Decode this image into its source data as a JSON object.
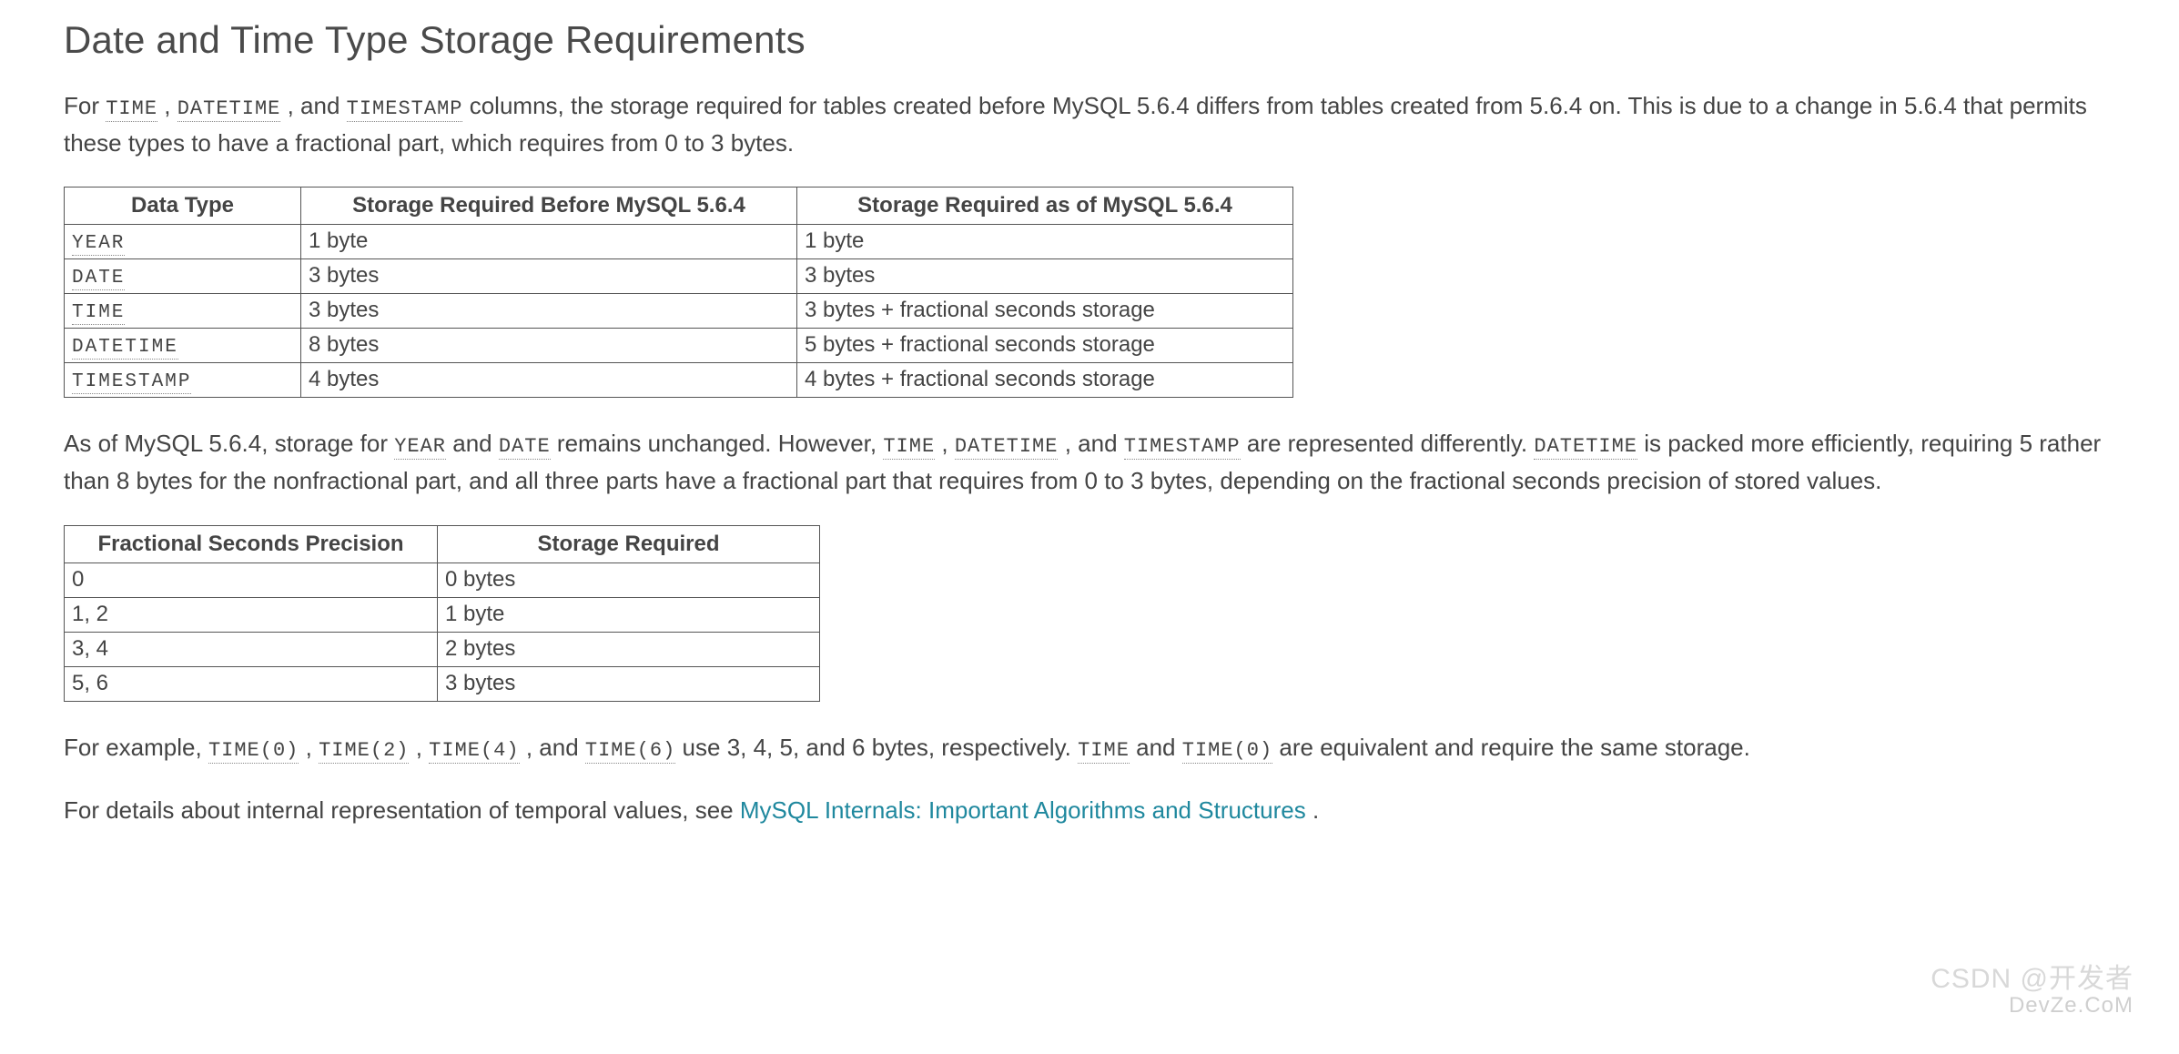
{
  "title": "Date and Time Type Storage Requirements",
  "para1": {
    "seg1": "For ",
    "code1": "TIME",
    "seg2": ", ",
    "code2": "DATETIME",
    "seg3": ", and ",
    "code3": "TIMESTAMP",
    "seg4": " columns, the storage required for tables created before MySQL 5.6.4 differs from tables created from 5.6.4 on. This is due to a change in 5.6.4 that permits these types to have a fractional part, which requires from 0 to 3 bytes."
  },
  "table1": {
    "headers": [
      "Data Type",
      "Storage Required Before MySQL 5.6.4",
      "Storage Required as of MySQL 5.6.4"
    ],
    "rows": [
      {
        "type": "YEAR",
        "before": "1 byte",
        "after": "1 byte"
      },
      {
        "type": "DATE",
        "before": "3 bytes",
        "after": "3 bytes"
      },
      {
        "type": "TIME",
        "before": "3 bytes",
        "after": "3 bytes + fractional seconds storage"
      },
      {
        "type": "DATETIME",
        "before": "8 bytes",
        "after": "5 bytes + fractional seconds storage"
      },
      {
        "type": "TIMESTAMP",
        "before": "4 bytes",
        "after": "4 bytes + fractional seconds storage"
      }
    ]
  },
  "para2": {
    "seg1": "As of MySQL 5.6.4, storage for ",
    "code1": "YEAR",
    "seg2": " and ",
    "code2": "DATE",
    "seg3": " remains unchanged. However, ",
    "code3": "TIME",
    "seg4": ", ",
    "code4": "DATETIME",
    "seg5": ", and ",
    "code5": "TIMESTAMP",
    "seg6": " are represented differently. ",
    "code6": "DATETIME",
    "seg7": " is packed more efficiently, requiring 5 rather than 8 bytes for the nonfractional part, and all three parts have a fractional part that requires from 0 to 3 bytes, depending on the fractional seconds precision of stored values."
  },
  "table2": {
    "headers": [
      "Fractional Seconds Precision",
      "Storage Required"
    ],
    "rows": [
      {
        "precision": "0",
        "storage": "0 bytes"
      },
      {
        "precision": "1, 2",
        "storage": "1 byte"
      },
      {
        "precision": "3, 4",
        "storage": "2 bytes"
      },
      {
        "precision": "5, 6",
        "storage": "3 bytes"
      }
    ]
  },
  "para3": {
    "seg1": "For example, ",
    "code1": "TIME(0)",
    "seg2": ", ",
    "code2": "TIME(2)",
    "seg3": ", ",
    "code3": "TIME(4)",
    "seg4": ", and ",
    "code4": "TIME(6)",
    "seg5": " use 3, 4, 5, and 6 bytes, respectively. ",
    "code5": "TIME",
    "seg6": " and ",
    "code6": "TIME(0)",
    "seg7": " are equivalent and require the same storage."
  },
  "para4": {
    "seg1": "For details about internal representation of temporal values, see ",
    "link_text": "MySQL Internals: Important Algorithms and Structures",
    "seg2": "."
  },
  "watermark": {
    "line1": "CSDN @开发者",
    "line2": "DevZe.CoM"
  }
}
